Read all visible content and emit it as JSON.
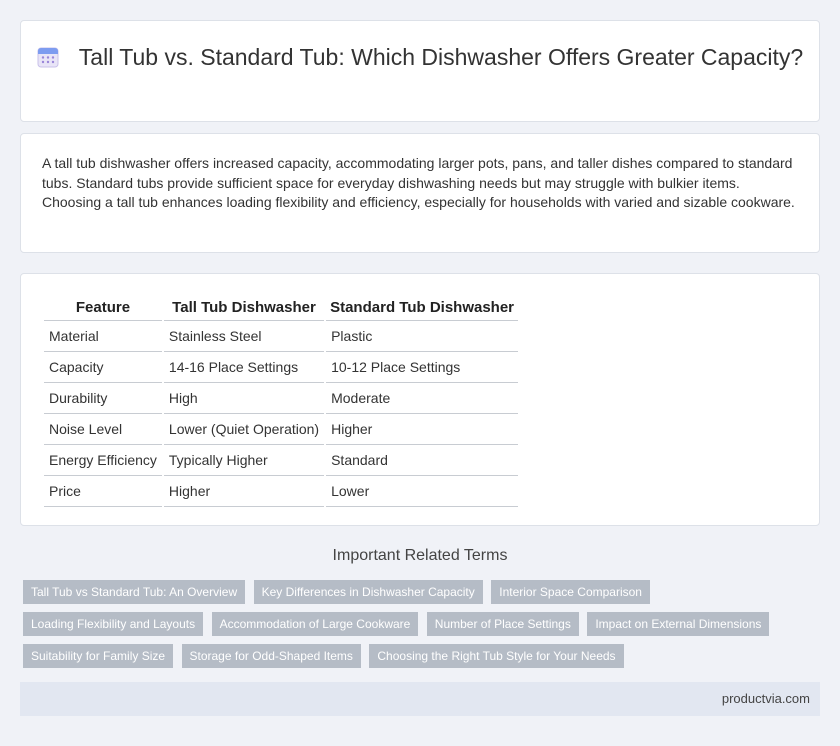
{
  "header": {
    "title": "Tall Tub vs. Standard Tub: Which Dishwasher Offers Greater Capacity?",
    "icon": "calendar-icon"
  },
  "summary": {
    "text": "A tall tub dishwasher offers increased capacity, accommodating larger pots, pans, and taller dishes compared to standard tubs. Standard tubs provide sufficient space for everyday dishwashing needs but may struggle with bulkier items. Choosing a tall tub enhances loading flexibility and efficiency, especially for households with varied and sizable cookware."
  },
  "table": {
    "headers": [
      "Feature",
      "Tall Tub Dishwasher",
      "Standard Tub Dishwasher"
    ],
    "rows": [
      [
        "Material",
        "Stainless Steel",
        "Plastic"
      ],
      [
        "Capacity",
        "14-16 Place Settings",
        "10-12 Place Settings"
      ],
      [
        "Durability",
        "High",
        "Moderate"
      ],
      [
        "Noise Level",
        "Lower (Quiet Operation)",
        "Higher"
      ],
      [
        "Energy Efficiency",
        "Typically Higher",
        "Standard"
      ],
      [
        "Price",
        "Higher",
        "Lower"
      ]
    ]
  },
  "related": {
    "heading": "Important Related Terms",
    "terms": [
      "Tall Tub vs Standard Tub: An Overview",
      "Key Differences in Dishwasher Capacity",
      "Interior Space Comparison",
      "Loading Flexibility and Layouts",
      "Accommodation of Large Cookware",
      "Number of Place Settings",
      "Impact on External Dimensions",
      "Suitability for Family Size",
      "Storage for Odd-Shaped Items",
      "Choosing the Right Tub Style for Your Needs"
    ]
  },
  "footer": {
    "site": "productvia.com"
  },
  "colors": {
    "background": "#f0f2f7",
    "tag": "#b5bcc6",
    "footer": "#e2e7f1"
  }
}
